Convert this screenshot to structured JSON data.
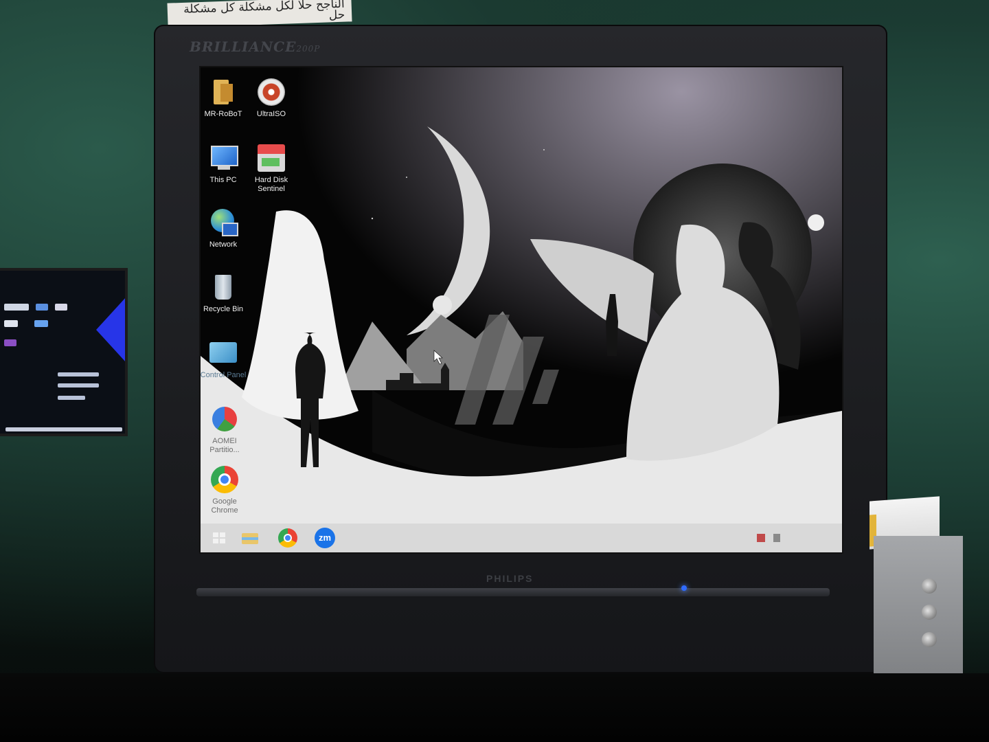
{
  "note": {
    "text": "الناجح حلا لكل مشكلة\nكل مشكلة حل"
  },
  "monitor": {
    "brand": "BRILLIANCE",
    "model": "200P",
    "maker": "PHILIPS"
  },
  "desktop": {
    "icons": [
      {
        "label": "MR-RoBoT",
        "icon": "folder-user-icon"
      },
      {
        "label": "UltraISO",
        "icon": "disc-icon"
      },
      {
        "label": "This PC",
        "icon": "computer-icon"
      },
      {
        "label": "Hard Disk Sentinel",
        "icon": "hard-disk-icon"
      },
      {
        "label": "Network",
        "icon": "network-globe-icon"
      },
      {
        "label": "Recycle Bin",
        "icon": "recycle-bin-icon"
      },
      {
        "label": "Control Panel",
        "icon": "control-panel-icon"
      },
      {
        "label": "AOMEI Partitio...",
        "icon": "partition-icon"
      },
      {
        "label": "Google Chrome",
        "icon": "chrome-icon"
      }
    ]
  },
  "taskbar": {
    "apps": [
      {
        "name": "start",
        "icon": "windows-start-icon"
      },
      {
        "name": "explorer",
        "icon": "file-explorer-icon"
      },
      {
        "name": "chrome",
        "icon": "chrome-icon"
      },
      {
        "name": "zoom",
        "icon": "zoom-icon",
        "text": "zm"
      }
    ]
  },
  "colors": {
    "screen_bg": "#000000",
    "wall_green": "#1f4a3d",
    "taskbar": "#d7d7d7",
    "zoom_blue": "#1a73e8"
  }
}
